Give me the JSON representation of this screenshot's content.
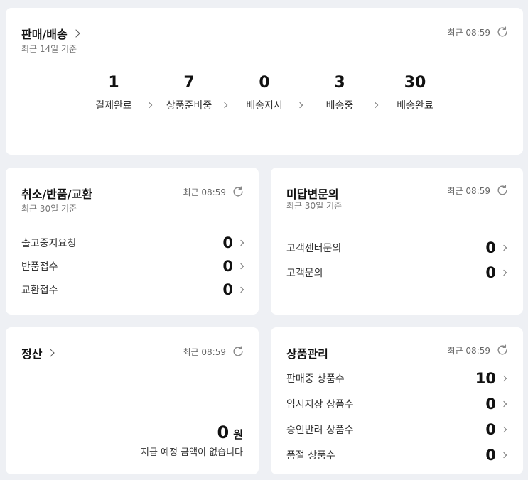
{
  "sales": {
    "title": "판매/배송",
    "subtitle": "최근 14일 기준",
    "updated": "최근 08:59",
    "stages": [
      {
        "value": "1",
        "label": "결제완료"
      },
      {
        "value": "7",
        "label": "상품준비중"
      },
      {
        "value": "0",
        "label": "배송지시"
      },
      {
        "value": "3",
        "label": "배송중"
      },
      {
        "value": "30",
        "label": "배송완료"
      }
    ]
  },
  "claims": {
    "title": "취소/반품/교환",
    "subtitle": "최근 30일 기준",
    "updated": "최근 08:59",
    "rows": [
      {
        "label": "출고중지요청",
        "value": "0"
      },
      {
        "label": "반품접수",
        "value": "0"
      },
      {
        "label": "교환접수",
        "value": "0"
      }
    ]
  },
  "inquiries": {
    "title": "미답변문의",
    "subtitle": "최근 30일 기준",
    "updated": "최근 08:59",
    "rows": [
      {
        "label": "고객센터문의",
        "value": "0"
      },
      {
        "label": "고객문의",
        "value": "0"
      }
    ]
  },
  "settlement": {
    "title": "정산",
    "updated": "최근 08:59",
    "amount": "0",
    "unit": "원",
    "note": "지급 예정 금액이 없습니다"
  },
  "products": {
    "title": "상품관리",
    "updated": "최근 08:59",
    "rows": [
      {
        "label": "판매중 상품수",
        "value": "10"
      },
      {
        "label": "임시저장 상품수",
        "value": "0"
      },
      {
        "label": "승인반려 상품수",
        "value": "0"
      },
      {
        "label": "품절 상품수",
        "value": "0"
      }
    ]
  },
  "icons": {
    "refresh": "refresh-icon",
    "chevron": "chevron-right-icon"
  }
}
